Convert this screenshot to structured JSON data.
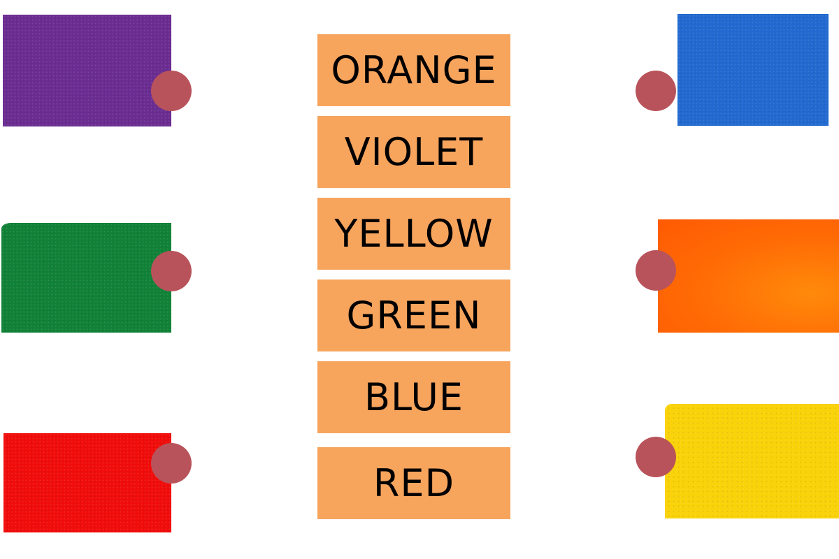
{
  "theme": {
    "dot_color": "#B9535B",
    "word_box_color": "#F7A45D",
    "text_color": "#000000"
  },
  "words": [
    {
      "label": "ORANGE"
    },
    {
      "label": "VIOLET"
    },
    {
      "label": "YELLOW"
    },
    {
      "label": "GREEN"
    },
    {
      "label": "BLUE"
    },
    {
      "label": "RED"
    }
  ],
  "left_swatches": [
    {
      "color_name": "violet",
      "color": "#6A2C91"
    },
    {
      "color_name": "green",
      "color": "#108137"
    },
    {
      "color_name": "red",
      "color": "#F00C0A"
    }
  ],
  "right_swatches": [
    {
      "color_name": "blue",
      "color": "#2169CF"
    },
    {
      "color_name": "orange",
      "color": "#FF6A05"
    },
    {
      "color_name": "yellow",
      "color": "#F9D208"
    }
  ]
}
